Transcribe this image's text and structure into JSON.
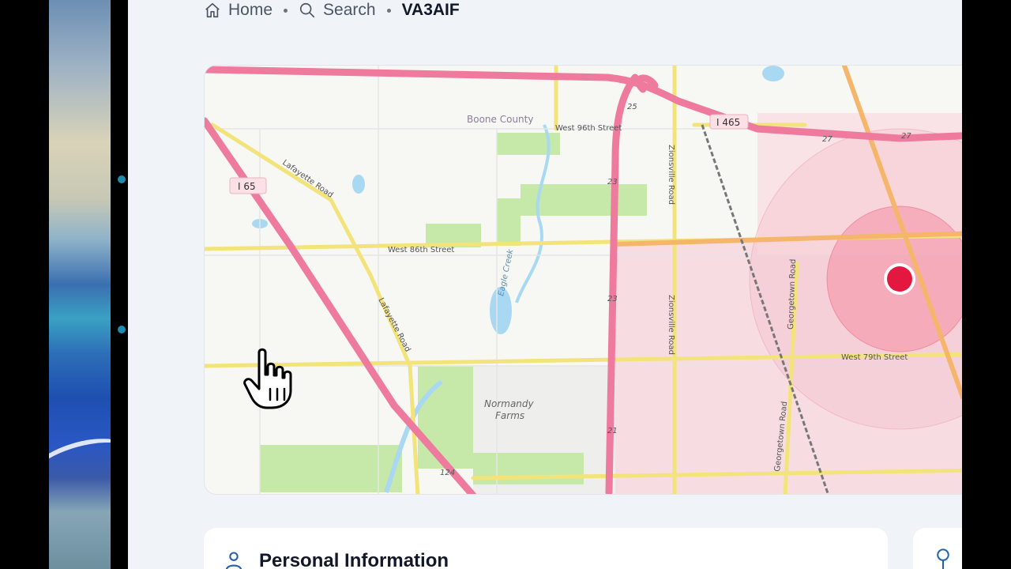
{
  "breadcrumb": {
    "home": "Home",
    "search": "Search",
    "current": "VA3AIF"
  },
  "map": {
    "labels": {
      "boone_county": "Boone County",
      "w96": "West 96th Street",
      "i465": "I 465",
      "i65": "I 65",
      "lafayette_1": "Lafayette Road",
      "lafayette_2": "Lafayette Road",
      "w86": "West 86th Street",
      "eagle_creek": "Eagle Creek",
      "zionsville_1": "Zionsville Road",
      "zionsville_2": "Zionsville Road",
      "georgetown_1": "Georgetown Road",
      "georgetown_2": "Georgetown Road",
      "w79": "West 79th Street",
      "normandy_1": "Normandy",
      "normandy_2": "Farms",
      "r25": "25",
      "r23a": "23",
      "r23b": "23",
      "r21": "21",
      "r27a": "27",
      "r27b": "27",
      "r124": "124"
    },
    "colors": {
      "highway": "#ee7a9e",
      "arterial": "#f2e47a",
      "orange_road": "#f5b56b",
      "park": "#c6e8a8",
      "water": "#a9d8f2",
      "urban": "#f7d7dc",
      "radius": "#f7a3b4",
      "marker": "#e3173f"
    }
  },
  "personal_info": {
    "title": "Personal Information"
  }
}
